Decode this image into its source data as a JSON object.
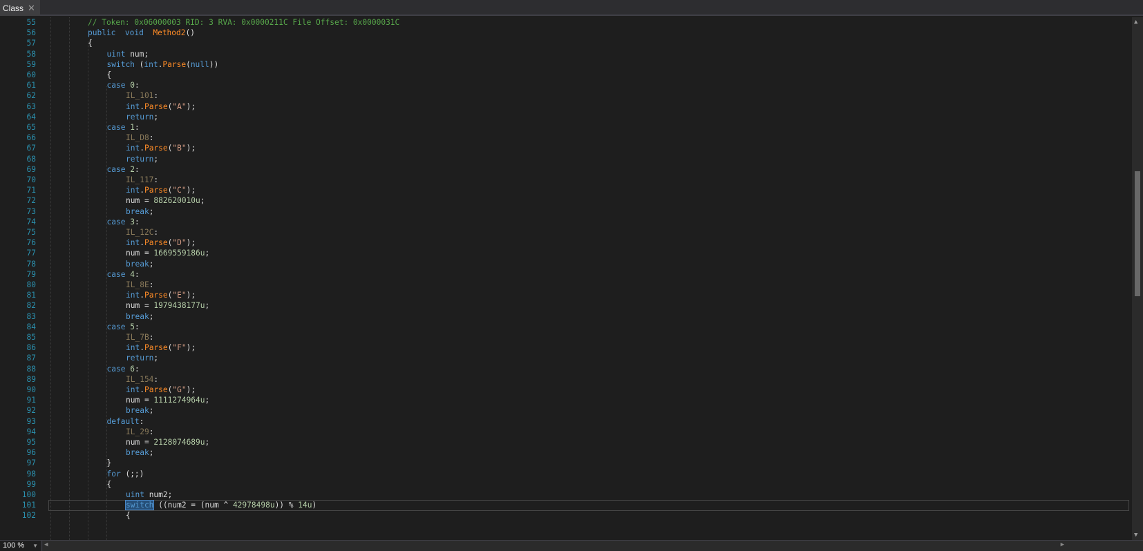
{
  "tab": {
    "title": "Class",
    "close_glyph": "✕"
  },
  "zoom": {
    "value": "100 %"
  },
  "editor": {
    "lines": [
      {
        "n": "55",
        "i": 0,
        "t": [
          [
            "cm",
            "// Token: 0x06000003 RID: 3 RVA: 0x0000211C File Offset: 0x0000031C"
          ]
        ]
      },
      {
        "n": "56",
        "i": 0,
        "t": [
          [
            "kw",
            "public"
          ],
          [
            "",
            "  "
          ],
          [
            "kw",
            "void"
          ],
          [
            "",
            "  "
          ],
          [
            "fn",
            "Method2"
          ],
          [
            "",
            "()"
          ]
        ]
      },
      {
        "n": "57",
        "i": 0,
        "t": [
          [
            "",
            "{"
          ]
        ]
      },
      {
        "n": "58",
        "i": 1,
        "t": [
          [
            "kw",
            "uint"
          ],
          [
            "",
            " num;"
          ]
        ]
      },
      {
        "n": "59",
        "i": 1,
        "t": [
          [
            "kw",
            "switch"
          ],
          [
            "",
            " ("
          ],
          [
            "kw",
            "int"
          ],
          [
            "",
            "."
          ],
          [
            "fn",
            "Parse"
          ],
          [
            "",
            "("
          ],
          [
            "kw",
            "null"
          ],
          [
            "",
            "))"
          ]
        ]
      },
      {
        "n": "60",
        "i": 1,
        "t": [
          [
            "",
            "{"
          ]
        ]
      },
      {
        "n": "61",
        "i": 1,
        "t": [
          [
            "kw",
            "case"
          ],
          [
            "",
            " "
          ],
          [
            "num",
            "0"
          ],
          [
            "",
            ":"
          ]
        ]
      },
      {
        "n": "62",
        "i": 2,
        "t": [
          [
            "lbl",
            "IL_101"
          ],
          [
            "",
            ":"
          ]
        ]
      },
      {
        "n": "63",
        "i": 2,
        "t": [
          [
            "kw",
            "int"
          ],
          [
            "",
            "."
          ],
          [
            "fn",
            "Parse"
          ],
          [
            "",
            "("
          ],
          [
            "str",
            "\"A\""
          ],
          [
            "",
            ");"
          ]
        ]
      },
      {
        "n": "64",
        "i": 2,
        "t": [
          [
            "kw",
            "return"
          ],
          [
            "",
            ";"
          ]
        ]
      },
      {
        "n": "65",
        "i": 1,
        "t": [
          [
            "kw",
            "case"
          ],
          [
            "",
            " "
          ],
          [
            "num",
            "1"
          ],
          [
            "",
            ":"
          ]
        ]
      },
      {
        "n": "66",
        "i": 2,
        "t": [
          [
            "lbl",
            "IL_D8"
          ],
          [
            "",
            ":"
          ]
        ]
      },
      {
        "n": "67",
        "i": 2,
        "t": [
          [
            "kw",
            "int"
          ],
          [
            "",
            "."
          ],
          [
            "fn",
            "Parse"
          ],
          [
            "",
            "("
          ],
          [
            "str",
            "\"B\""
          ],
          [
            "",
            ");"
          ]
        ]
      },
      {
        "n": "68",
        "i": 2,
        "t": [
          [
            "kw",
            "return"
          ],
          [
            "",
            ";"
          ]
        ]
      },
      {
        "n": "69",
        "i": 1,
        "t": [
          [
            "kw",
            "case"
          ],
          [
            "",
            " "
          ],
          [
            "num",
            "2"
          ],
          [
            "",
            ":"
          ]
        ]
      },
      {
        "n": "70",
        "i": 2,
        "t": [
          [
            "lbl",
            "IL_117"
          ],
          [
            "",
            ":"
          ]
        ]
      },
      {
        "n": "71",
        "i": 2,
        "t": [
          [
            "kw",
            "int"
          ],
          [
            "",
            "."
          ],
          [
            "fn",
            "Parse"
          ],
          [
            "",
            "("
          ],
          [
            "str",
            "\"C\""
          ],
          [
            "",
            ");"
          ]
        ]
      },
      {
        "n": "72",
        "i": 2,
        "t": [
          [
            "",
            "num = "
          ],
          [
            "num",
            "882620010u"
          ],
          [
            "",
            ";"
          ]
        ]
      },
      {
        "n": "73",
        "i": 2,
        "t": [
          [
            "kw",
            "break"
          ],
          [
            "",
            ";"
          ]
        ]
      },
      {
        "n": "74",
        "i": 1,
        "t": [
          [
            "kw",
            "case"
          ],
          [
            "",
            " "
          ],
          [
            "num",
            "3"
          ],
          [
            "",
            ":"
          ]
        ]
      },
      {
        "n": "75",
        "i": 2,
        "t": [
          [
            "lbl",
            "IL_12C"
          ],
          [
            "",
            ":"
          ]
        ]
      },
      {
        "n": "76",
        "i": 2,
        "t": [
          [
            "kw",
            "int"
          ],
          [
            "",
            "."
          ],
          [
            "fn",
            "Parse"
          ],
          [
            "",
            "("
          ],
          [
            "str",
            "\"D\""
          ],
          [
            "",
            ");"
          ]
        ]
      },
      {
        "n": "77",
        "i": 2,
        "t": [
          [
            "",
            "num = "
          ],
          [
            "num",
            "1669559186u"
          ],
          [
            "",
            ";"
          ]
        ]
      },
      {
        "n": "78",
        "i": 2,
        "t": [
          [
            "kw",
            "break"
          ],
          [
            "",
            ";"
          ]
        ]
      },
      {
        "n": "79",
        "i": 1,
        "t": [
          [
            "kw",
            "case"
          ],
          [
            "",
            " "
          ],
          [
            "num",
            "4"
          ],
          [
            "",
            ":"
          ]
        ]
      },
      {
        "n": "80",
        "i": 2,
        "t": [
          [
            "lbl",
            "IL_8E"
          ],
          [
            "",
            ":"
          ]
        ]
      },
      {
        "n": "81",
        "i": 2,
        "t": [
          [
            "kw",
            "int"
          ],
          [
            "",
            "."
          ],
          [
            "fn",
            "Parse"
          ],
          [
            "",
            "("
          ],
          [
            "str",
            "\"E\""
          ],
          [
            "",
            ");"
          ]
        ]
      },
      {
        "n": "82",
        "i": 2,
        "t": [
          [
            "",
            "num = "
          ],
          [
            "num",
            "1979438177u"
          ],
          [
            "",
            ";"
          ]
        ]
      },
      {
        "n": "83",
        "i": 2,
        "t": [
          [
            "kw",
            "break"
          ],
          [
            "",
            ";"
          ]
        ]
      },
      {
        "n": "84",
        "i": 1,
        "t": [
          [
            "kw",
            "case"
          ],
          [
            "",
            " "
          ],
          [
            "num",
            "5"
          ],
          [
            "",
            ":"
          ]
        ]
      },
      {
        "n": "85",
        "i": 2,
        "t": [
          [
            "lbl",
            "IL_7B"
          ],
          [
            "",
            ":"
          ]
        ]
      },
      {
        "n": "86",
        "i": 2,
        "t": [
          [
            "kw",
            "int"
          ],
          [
            "",
            "."
          ],
          [
            "fn",
            "Parse"
          ],
          [
            "",
            "("
          ],
          [
            "str",
            "\"F\""
          ],
          [
            "",
            ");"
          ]
        ]
      },
      {
        "n": "87",
        "i": 2,
        "t": [
          [
            "kw",
            "return"
          ],
          [
            "",
            ";"
          ]
        ]
      },
      {
        "n": "88",
        "i": 1,
        "t": [
          [
            "kw",
            "case"
          ],
          [
            "",
            " "
          ],
          [
            "num",
            "6"
          ],
          [
            "",
            ":"
          ]
        ]
      },
      {
        "n": "89",
        "i": 2,
        "t": [
          [
            "lbl",
            "IL_154"
          ],
          [
            "",
            ":"
          ]
        ]
      },
      {
        "n": "90",
        "i": 2,
        "t": [
          [
            "kw",
            "int"
          ],
          [
            "",
            "."
          ],
          [
            "fn",
            "Parse"
          ],
          [
            "",
            "("
          ],
          [
            "str",
            "\"G\""
          ],
          [
            "",
            ");"
          ]
        ]
      },
      {
        "n": "91",
        "i": 2,
        "t": [
          [
            "",
            "num = "
          ],
          [
            "num",
            "1111274964u"
          ],
          [
            "",
            ";"
          ]
        ]
      },
      {
        "n": "92",
        "i": 2,
        "t": [
          [
            "kw",
            "break"
          ],
          [
            "",
            ";"
          ]
        ]
      },
      {
        "n": "93",
        "i": 1,
        "t": [
          [
            "kw",
            "default"
          ],
          [
            "",
            ":"
          ]
        ]
      },
      {
        "n": "94",
        "i": 2,
        "t": [
          [
            "lbl",
            "IL_29"
          ],
          [
            "",
            ":"
          ]
        ]
      },
      {
        "n": "95",
        "i": 2,
        "t": [
          [
            "",
            "num = "
          ],
          [
            "num",
            "2128074689u"
          ],
          [
            "",
            ";"
          ]
        ]
      },
      {
        "n": "96",
        "i": 2,
        "t": [
          [
            "kw",
            "break"
          ],
          [
            "",
            ";"
          ]
        ]
      },
      {
        "n": "97",
        "i": 1,
        "t": [
          [
            "",
            "}"
          ]
        ]
      },
      {
        "n": "98",
        "i": 1,
        "t": [
          [
            "kw",
            "for"
          ],
          [
            "",
            " (;;)"
          ]
        ]
      },
      {
        "n": "99",
        "i": 1,
        "t": [
          [
            "",
            "{"
          ]
        ]
      },
      {
        "n": "100",
        "i": 2,
        "t": [
          [
            "kw",
            "uint"
          ],
          [
            "",
            " num2;"
          ]
        ]
      },
      {
        "n": "101",
        "i": 2,
        "t": [
          [
            "kwsel",
            "switch"
          ],
          [
            "",
            " ((num2 = (num ^ "
          ],
          [
            "num",
            "42978498u"
          ],
          [
            "",
            ")) % "
          ],
          [
            "num",
            "14u"
          ],
          [
            "",
            ")"
          ]
        ]
      },
      {
        "n": "102",
        "i": 2,
        "t": [
          [
            "",
            "{"
          ]
        ]
      }
    ],
    "current_line": "101"
  },
  "colors": {
    "keyword": "#569cd6",
    "method": "#ff8c27",
    "string": "#d69d85",
    "number": "#b5cea8",
    "comment": "#57a64a",
    "label": "#8a7a5a",
    "line_number": "#2b91af",
    "background": "#1e1e1e"
  },
  "icons": {
    "tab_close": "close-icon",
    "zoom_dropdown": "chevron-down-icon",
    "scroll_up": "arrow-up-icon",
    "scroll_down": "arrow-down-icon",
    "scroll_left": "arrow-left-icon",
    "scroll_right": "arrow-right-icon"
  }
}
